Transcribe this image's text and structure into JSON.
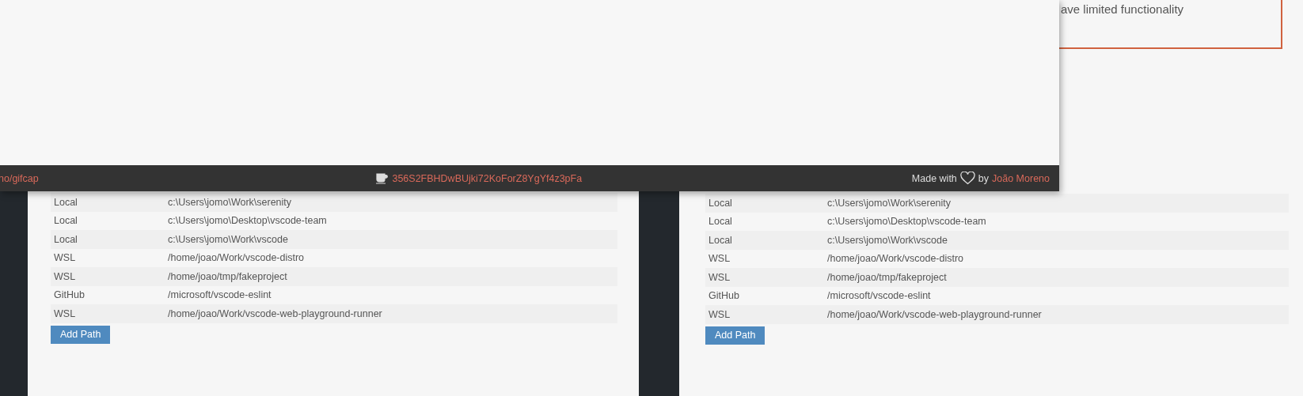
{
  "overlay_window": {
    "footer": {
      "repo_link": "no/gifcap",
      "donation_address": "356S2FBHDwBUjki72KoForZ8YgYf4z3pFa",
      "credit_prefix": "Made with",
      "credit_by": "by",
      "author_link": "João Moreno"
    }
  },
  "notice": {
    "text": "ave limited functionality"
  },
  "panels": [
    {
      "paths": [
        {
          "type": "Local",
          "path": "c:\\Users\\jomo\\Work\\serenity"
        },
        {
          "type": "Local",
          "path": "c:\\Users\\jomo\\Desktop\\vscode-team"
        },
        {
          "type": "Local",
          "path": "c:\\Users\\jomo\\Work\\vscode"
        },
        {
          "type": "WSL",
          "path": "/home/joao/Work/vscode-distro"
        },
        {
          "type": "WSL",
          "path": "/home/joao/tmp/fakeproject"
        },
        {
          "type": "GitHub",
          "path": "/microsoft/vscode-eslint"
        },
        {
          "type": "WSL",
          "path": "/home/joao/Work/vscode-web-playground-runner"
        }
      ],
      "add_button": "Add Path"
    },
    {
      "paths": [
        {
          "type": "Local",
          "path": "c:\\Users\\jomo\\Work\\serenity"
        },
        {
          "type": "Local",
          "path": "c:\\Users\\jomo\\Desktop\\vscode-team"
        },
        {
          "type": "Local",
          "path": "c:\\Users\\jomo\\Work\\vscode"
        },
        {
          "type": "WSL",
          "path": "/home/joao/Work/vscode-distro"
        },
        {
          "type": "WSL",
          "path": "/home/joao/tmp/fakeproject"
        },
        {
          "type": "GitHub",
          "path": "/microsoft/vscode-eslint"
        },
        {
          "type": "WSL",
          "path": "/home/joao/Work/vscode-web-playground-runner"
        }
      ],
      "add_button": "Add Path"
    }
  ]
}
